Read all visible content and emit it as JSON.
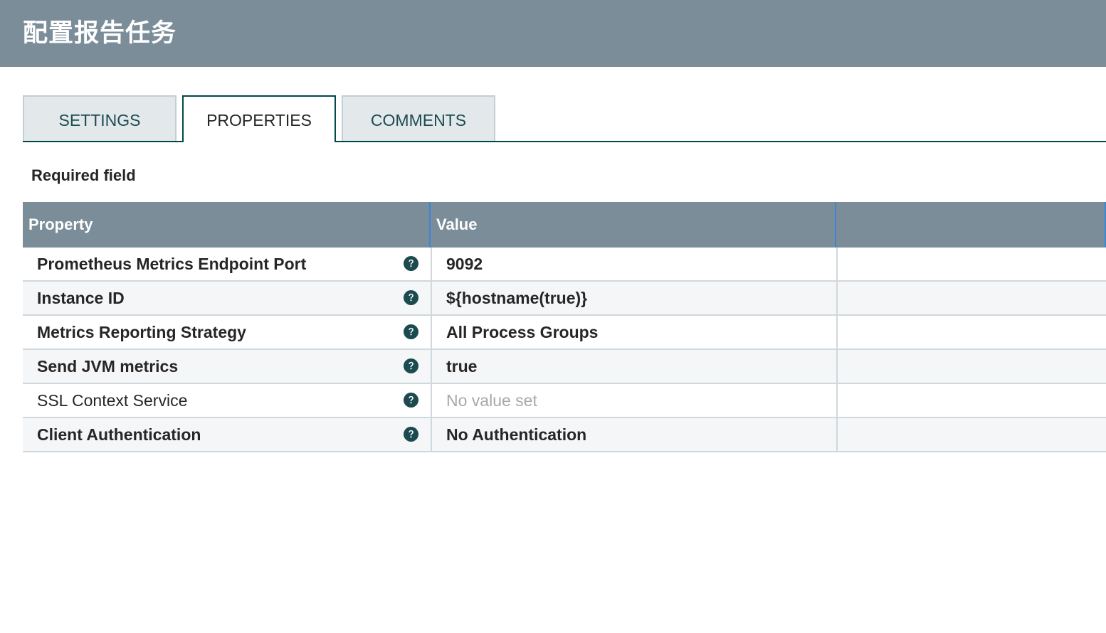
{
  "header": {
    "title": "配置报告任务"
  },
  "tabs": [
    {
      "label": "SETTINGS",
      "active": false
    },
    {
      "label": "PROPERTIES",
      "active": true
    },
    {
      "label": "COMMENTS",
      "active": false
    }
  ],
  "required_label": "Required field",
  "grid": {
    "columns": {
      "property": "Property",
      "value": "Value",
      "extra": ""
    },
    "rows": [
      {
        "property": "Prometheus Metrics Endpoint Port",
        "value": "9092",
        "required": true,
        "value_set": true
      },
      {
        "property": "Instance ID",
        "value": "${hostname(true)}",
        "required": true,
        "value_set": true
      },
      {
        "property": "Metrics Reporting Strategy",
        "value": "All Process Groups",
        "required": true,
        "value_set": true
      },
      {
        "property": "Send JVM metrics",
        "value": "true",
        "required": true,
        "value_set": true
      },
      {
        "property": "SSL Context Service",
        "value": "No value set",
        "required": false,
        "value_set": false
      },
      {
        "property": "Client Authentication",
        "value": "No Authentication",
        "required": true,
        "value_set": true
      }
    ]
  },
  "icons": {
    "help": "question-circle-icon"
  },
  "colors": {
    "header_bg": "#7a8d99",
    "accent": "#004849",
    "column_divider": "#3a87d6",
    "unset_value": "#a8a8a8"
  }
}
